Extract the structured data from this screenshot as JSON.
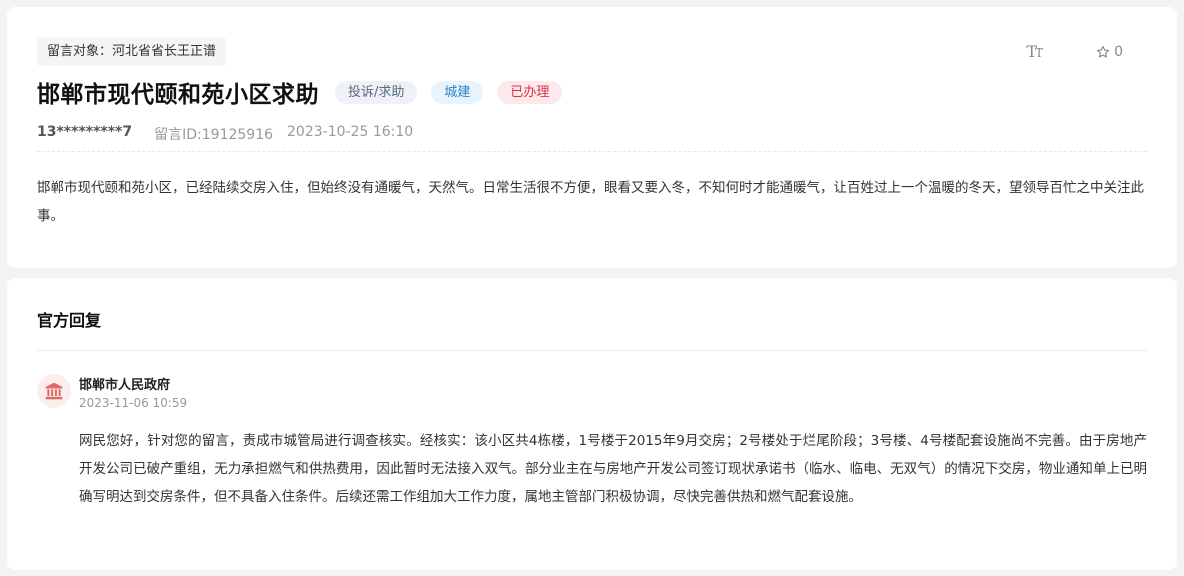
{
  "message": {
    "target_label": "留言对象：河北省省长王正谱",
    "font_tool_big": "T",
    "font_tool_small": "T",
    "favorite_count": "0",
    "title": "邯郸市现代颐和苑小区求助",
    "tags": {
      "type": "投诉/求助",
      "category": "城建",
      "status": "已办理"
    },
    "author_phone": "13*********7",
    "message_id": "留言ID:19125916",
    "datetime": "2023-10-25 16:10",
    "content": "邯郸市现代颐和苑小区，已经陆续交房入住，但始终没有通暖气，天然气。日常生活很不方便，眼看又要入冬，不知何时才能通暖气，让百姓过上一个温暖的冬天，望领导百忙之中关注此事。"
  },
  "reply": {
    "heading": "官方回复",
    "org_name": "邯郸市人民政府",
    "org_icon": "government-building-icon",
    "datetime": "2023-11-06 10:59",
    "content": "网民您好，针对您的留言，责成市城管局进行调查核实。经核实：该小区共4栋楼，1号楼于2015年9月交房；2号楼处于烂尾阶段；3号楼、4号楼配套设施尚不完善。由于房地产开发公司已破产重组，无力承担燃气和供热费用，因此暂时无法接入双气。部分业主在与房地产开发公司签订现状承诺书（临水、临电、无双气）的情况下交房，物业通知单上已明确写明达到交房条件，但不具备入住条件。后续还需工作组加大工作力度，属地主管部门积极协调，尽快完善供热和燃气配套设施。"
  },
  "colors": {
    "status_tag": "#d6334c",
    "category_tag": "#2f7fc4",
    "org_icon": "#e06a6a"
  }
}
